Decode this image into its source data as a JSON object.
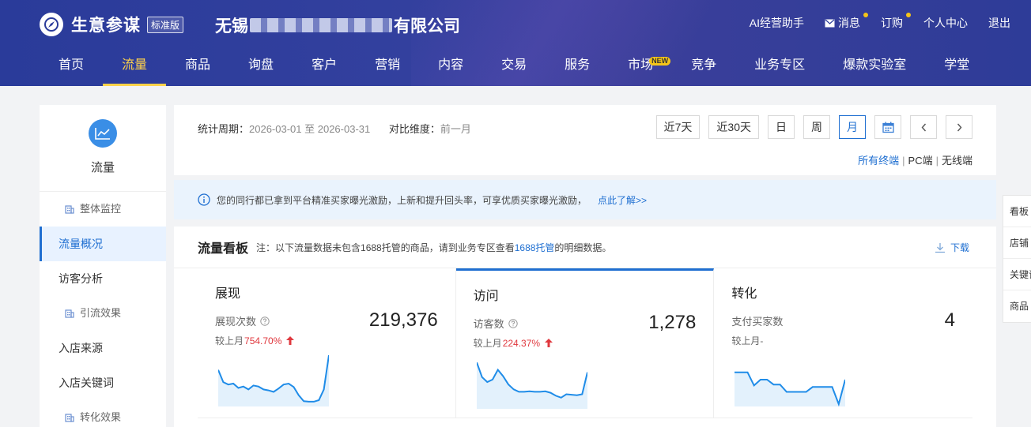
{
  "header": {
    "brand": "生意参谋",
    "edition": "标准版",
    "company_prefix": "无锡",
    "company_suffix": "有限公司",
    "top_links": [
      {
        "label": "AI经营助手",
        "icon": "",
        "dot": false
      },
      {
        "label": "消息",
        "icon": "mail-icon",
        "dot": true
      },
      {
        "label": "订购",
        "icon": "",
        "dot": true
      },
      {
        "label": "个人中心",
        "icon": "",
        "dot": false
      },
      {
        "label": "退出",
        "icon": "",
        "dot": false
      }
    ],
    "accent": "#ffd24a"
  },
  "nav": [
    {
      "label": "首页"
    },
    {
      "label": "流量",
      "active": true
    },
    {
      "label": "商品"
    },
    {
      "label": "询盘"
    },
    {
      "label": "客户"
    },
    {
      "label": "营销"
    },
    {
      "label": "内容"
    },
    {
      "label": "交易"
    },
    {
      "label": "服务"
    },
    {
      "label": "市场",
      "badge": "NEW"
    },
    {
      "label": "竞争"
    },
    {
      "label": "业务专区"
    },
    {
      "label": "爆款实验室"
    },
    {
      "label": "学堂"
    }
  ],
  "sidebar": {
    "title": "流量",
    "items": [
      {
        "label": "整体监控",
        "group": true
      },
      {
        "label": "流量概况",
        "active": true
      },
      {
        "label": "访客分析"
      },
      {
        "label": "引流效果",
        "group": true
      },
      {
        "label": "入店来源"
      },
      {
        "label": "入店关键词"
      },
      {
        "label": "转化效果",
        "group": true
      }
    ]
  },
  "filter": {
    "period_label": "统计周期：",
    "period_value": "2026-03-01 至 2026-03-31",
    "compare_label": "对比维度：",
    "compare_value": "前一月",
    "buttons": [
      "近7天",
      "近30天",
      "日",
      "周",
      "月"
    ],
    "active_button": "月",
    "terminals": [
      "所有终端",
      "PC端",
      "无线端"
    ],
    "active_terminal": "所有终端",
    "separator": "|"
  },
  "notice": {
    "text": "您的同行都已拿到平台精准买家曝光激励，上新和提升回头率，可享优质买家曝光激励，",
    "link": "点此了解>>"
  },
  "board": {
    "title": "流量看板",
    "note_before": "注：以下流量数据未包含1688托管的商品，请到业务专区查看",
    "note_link": "1688托管",
    "note_after": "的明细数据。",
    "download": "下载",
    "panels": [
      {
        "title": "展现",
        "metric": "展现次数",
        "value": "219,376",
        "compare_label": "较上月",
        "compare_value": "754.70%",
        "trend": "up",
        "spark": [
          0.7,
          0.45,
          0.4,
          0.42,
          0.33,
          0.36,
          0.3,
          0.38,
          0.36,
          0.3,
          0.28,
          0.25,
          0.32,
          0.4,
          0.42,
          0.35,
          0.18,
          0.06,
          0.05,
          0.05,
          0.08,
          0.3,
          1.0
        ]
      },
      {
        "title": "访问",
        "metric": "访客数",
        "value": "1,278",
        "compare_label": "较上月",
        "compare_value": "224.37%",
        "trend": "up",
        "spark": [
          0.9,
          0.6,
          0.5,
          0.55,
          0.75,
          0.62,
          0.45,
          0.35,
          0.3,
          0.3,
          0.31,
          0.3,
          0.3,
          0.31,
          0.28,
          0.22,
          0.18,
          0.25,
          0.24,
          0.23,
          0.25,
          0.7
        ]
      },
      {
        "title": "转化",
        "metric": "支付买家数",
        "value": "4",
        "compare_label": "较上月",
        "compare_value": "-",
        "trend": "none",
        "spark": [
          0.65,
          0.65,
          0.65,
          0.38,
          0.5,
          0.5,
          0.4,
          0.4,
          0.25,
          0.25,
          0.25,
          0.25,
          0.35,
          0.35,
          0.35,
          0.35,
          0.0,
          0.5
        ]
      }
    ],
    "line_color": "#1f8ce8",
    "fill_color": "#e3f1fc"
  },
  "right_tabs": [
    "看板",
    "店铺",
    "关键词",
    "商品"
  ]
}
